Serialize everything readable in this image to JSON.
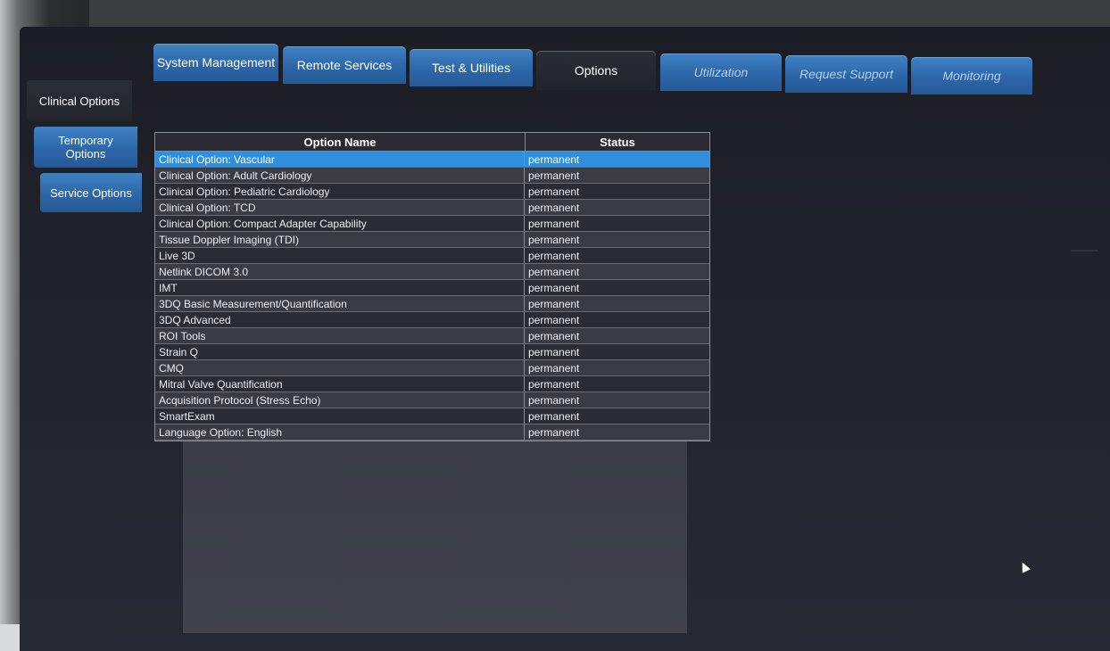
{
  "tabs": [
    {
      "label": "System Management"
    },
    {
      "label": "Remote Services"
    },
    {
      "label": "Test & Utilities"
    },
    {
      "label": "Options"
    },
    {
      "label": "Utilization"
    },
    {
      "label": "Request Support"
    },
    {
      "label": "Monitoring"
    }
  ],
  "active_tab": "Options",
  "side_tabs": [
    {
      "label": "Clinical Options"
    },
    {
      "label": "Temporary Options"
    },
    {
      "label": "Service Options"
    }
  ],
  "active_side_tab": "Clinical Options",
  "table": {
    "headers": [
      "Option Name",
      "Status"
    ],
    "rows": [
      {
        "name": "Clinical Option: Vascular",
        "status": "permanent"
      },
      {
        "name": "Clinical Option: Adult Cardiology",
        "status": "permanent"
      },
      {
        "name": "Clinical Option: Pediatric Cardiology",
        "status": "permanent"
      },
      {
        "name": "Clinical Option: TCD",
        "status": "permanent"
      },
      {
        "name": "Clinical Option: Compact Adapter Capability",
        "status": "permanent"
      },
      {
        "name": "Tissue Doppler Imaging (TDI)",
        "status": "permanent"
      },
      {
        "name": "Live 3D",
        "status": "permanent"
      },
      {
        "name": "Netlink DICOM 3.0",
        "status": "permanent"
      },
      {
        "name": "IMT",
        "status": "permanent"
      },
      {
        "name": "3DQ Basic Measurement/Quantification",
        "status": "permanent"
      },
      {
        "name": "3DQ Advanced",
        "status": "permanent"
      },
      {
        "name": "ROI Tools",
        "status": "permanent"
      },
      {
        "name": "Strain Q",
        "status": "permanent"
      },
      {
        "name": "CMQ",
        "status": "permanent"
      },
      {
        "name": "Mitral Valve Quantification",
        "status": "permanent"
      },
      {
        "name": "Acquisition Protocol (Stress Echo)",
        "status": "permanent"
      },
      {
        "name": "SmartExam",
        "status": "permanent"
      },
      {
        "name": "Language Option: English",
        "status": "permanent"
      }
    ],
    "selected_row": 0
  },
  "colors": {
    "tab_blue": "#2c66a8",
    "selection": "#2f8fdc",
    "screen_bg": "#21232c"
  }
}
